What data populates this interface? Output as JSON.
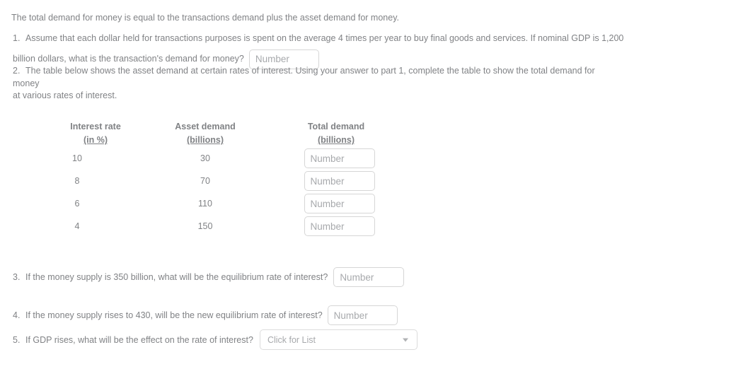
{
  "intro": {
    "text": "The total demand for money is equal to the transactions demand plus the asset demand for money."
  },
  "questions": [
    {
      "number": "1.",
      "line1": "Assume that each dollar held for transactions purposes is spent on the average 4 times per year to buy final goods and services. If nominal GDP is  1,200",
      "line2": "billion dollars, what is the transaction's demand for money?",
      "input_placeholder": "Number",
      "input_value": ""
    },
    {
      "number": "2.",
      "line1": "The table below shows the asset demand at certain rates of interest. Using your answer to part 1, complete the table to show the total demand for money",
      "line2": "at various rates of interest."
    },
    {
      "number": "3.",
      "text": "If the money supply is 350 billion, what will be the equilibrium rate of interest?",
      "input_placeholder": "Number",
      "input_value": ""
    },
    {
      "number": "4.",
      "text": "If the money supply rises to 430, will be the new equilibrium rate of interest?",
      "input_placeholder": "Number",
      "input_value": ""
    },
    {
      "number": "5.",
      "text": "If GDP rises, what will be the effect on the rate of interest?",
      "select_placeholder": "Click for List",
      "select_value": ""
    }
  ],
  "table": {
    "headers": [
      {
        "line1": "Interest rate",
        "line2": "(in %)"
      },
      {
        "line1": "Asset demand",
        "line2": "(billions)"
      },
      {
        "line1": "Total demand",
        "line2": "(billions)"
      }
    ],
    "rows": [
      {
        "interest_rate": "10",
        "asset_demand": "30",
        "total_demand_placeholder": "Number",
        "total_demand_value": ""
      },
      {
        "interest_rate": "8",
        "asset_demand": "70",
        "total_demand_placeholder": "Number",
        "total_demand_value": ""
      },
      {
        "interest_rate": "6",
        "asset_demand": "110",
        "total_demand_placeholder": "Number",
        "total_demand_value": ""
      },
      {
        "interest_rate": "4",
        "asset_demand": "150",
        "total_demand_placeholder": "Number",
        "total_demand_value": ""
      }
    ]
  },
  "colors": {
    "text": "#808285",
    "placeholder": "#a7a9ac",
    "border": "#d6d6d6",
    "background": "#ffffff"
  }
}
